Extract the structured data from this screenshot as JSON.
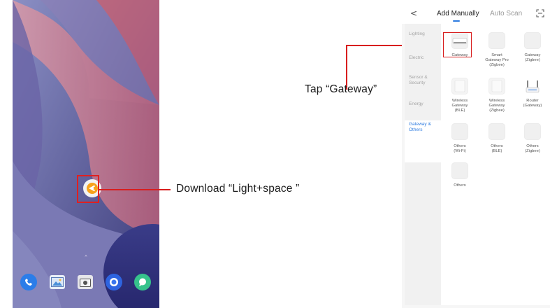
{
  "annotations": {
    "gateway_instruction": "Tap “Gateway”",
    "download_instruction": "Download “Light+space ”",
    "highlight_color": "#d81e1e"
  },
  "phone": {
    "app_icon": "lightspace-app-icon",
    "dock_icons": [
      "phone-icon",
      "gallery-icon",
      "camera-icon",
      "browser-icon",
      "messages-icon"
    ]
  },
  "app": {
    "header": {
      "back_icon": "chevron-left-icon",
      "tabs": [
        {
          "label": "Add Manually",
          "active": true
        },
        {
          "label": "Auto Scan",
          "active": false
        }
      ],
      "scan_icon": "scan-icon",
      "accent_color": "#2d7be0"
    },
    "categories": [
      {
        "label": "Lighting",
        "active": false
      },
      {
        "label": "Electric",
        "active": false
      },
      {
        "label": "Sensor &\nSecurity",
        "active": false
      },
      {
        "label": "Energy",
        "active": false
      },
      {
        "label": "Gateway &\nOthers",
        "active": true
      }
    ],
    "devices": [
      {
        "label": "Gateway"
      },
      {
        "label": "Smart\nGateway Pro\n(Zigbee)"
      },
      {
        "label": "Gateway\n(Zigbee)"
      },
      {
        "label": "Wireless\nGateway\n(BLE)"
      },
      {
        "label": "Wireless\nGateway\n(Zigbee)"
      },
      {
        "label": "Router\n(Gateway)"
      },
      {
        "label": "Others\n(Wi-Fi)"
      },
      {
        "label": "Others\n(BLE)"
      },
      {
        "label": "Others\n(Zigbee)"
      },
      {
        "label": "Others"
      }
    ]
  }
}
